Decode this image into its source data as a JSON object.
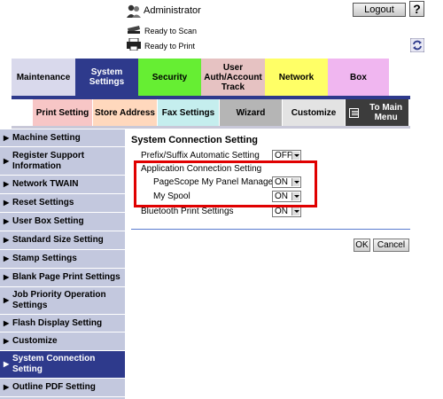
{
  "header": {
    "user": "Administrator",
    "logout_label": "Logout",
    "help_label": "?",
    "status_scan": "Ready to Scan",
    "status_print": "Ready to Print"
  },
  "main_tabs": [
    {
      "label": "Maintenance"
    },
    {
      "label": "System Settings"
    },
    {
      "label": "Security"
    },
    {
      "label": "User Auth/Account Track"
    },
    {
      "label": "Network"
    },
    {
      "label": "Box"
    }
  ],
  "sub_tabs": [
    {
      "label": "Print Setting"
    },
    {
      "label": "Store Address"
    },
    {
      "label": "Fax Settings"
    },
    {
      "label": "Wizard"
    },
    {
      "label": "Customize"
    },
    {
      "label": "To Main Menu"
    }
  ],
  "sidebar": {
    "items": [
      {
        "label": "Machine Setting"
      },
      {
        "label": "Register Support Information"
      },
      {
        "label": "Network TWAIN"
      },
      {
        "label": "Reset Settings"
      },
      {
        "label": "User Box Setting"
      },
      {
        "label": "Standard Size Setting"
      },
      {
        "label": "Stamp Settings"
      },
      {
        "label": "Blank Page Print Settings"
      },
      {
        "label": "Job Priority Operation Settings"
      },
      {
        "label": "Flash Display Setting"
      },
      {
        "label": "Customize"
      },
      {
        "label": "System Connection Setting"
      },
      {
        "label": "Outline PDF Setting"
      }
    ],
    "active_index": 11
  },
  "content": {
    "title": "System Connection Setting",
    "prefix_label": "Prefix/Suffix Automatic Setting",
    "prefix_value": "OFF",
    "app_conn_label": "Application Connection Setting",
    "pagescope_label": "PageScope My Panel Manager",
    "pagescope_value": "ON",
    "myspool_label": "My Spool",
    "myspool_value": "ON",
    "bluetooth_label": "Bluetooth Print Settings",
    "bluetooth_value": "ON",
    "ok_label": "OK",
    "cancel_label": "Cancel"
  },
  "colors": {
    "active_tab": "#2e3a8c",
    "sidebar_bg": "#c3c8de",
    "highlight_frame": "#e00000"
  }
}
